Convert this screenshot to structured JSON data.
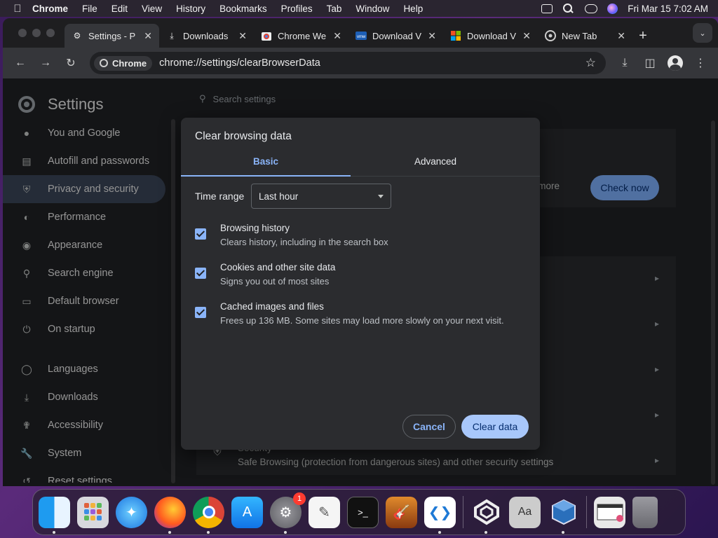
{
  "menubar": {
    "app_name": "Chrome",
    "items": [
      "File",
      "Edit",
      "View",
      "History",
      "Bookmarks",
      "Profiles",
      "Tab",
      "Window",
      "Help"
    ],
    "clock": "Fri Mar 15  7:02 AM"
  },
  "tabs": [
    {
      "title": "Settings - P",
      "icon": "gear-icon",
      "active": true
    },
    {
      "title": "Downloads",
      "icon": "download-icon",
      "active": false
    },
    {
      "title": "Chrome We",
      "icon": "chrome-web-store-icon",
      "active": false
    },
    {
      "title": "Download V",
      "icon": "vmware-icon",
      "active": false
    },
    {
      "title": "Download V",
      "icon": "microsoft-icon",
      "active": false
    },
    {
      "title": "New Tab",
      "icon": "chrome-icon",
      "active": false
    }
  ],
  "toolbar": {
    "chip_label": "Chrome",
    "url": "chrome://settings/clearBrowserData"
  },
  "settings": {
    "title": "Settings",
    "search_placeholder": "Search settings",
    "nav": [
      {
        "label": "You and Google",
        "icon": "person-icon",
        "active": false
      },
      {
        "label": "Autofill and passwords",
        "icon": "clipboard-icon",
        "active": false
      },
      {
        "label": "Privacy and security",
        "icon": "shield-icon",
        "active": true
      },
      {
        "label": "Performance",
        "icon": "speedometer-icon",
        "active": false
      },
      {
        "label": "Appearance",
        "icon": "palette-icon",
        "active": false
      },
      {
        "label": "Search engine",
        "icon": "search-icon",
        "active": false
      },
      {
        "label": "Default browser",
        "icon": "browser-icon",
        "active": false
      },
      {
        "label": "On startup",
        "icon": "power-icon",
        "active": false
      },
      {
        "label": "Languages",
        "icon": "globe-icon",
        "active": false
      },
      {
        "label": "Downloads",
        "icon": "download-icon",
        "active": false
      },
      {
        "label": "Accessibility",
        "icon": "accessibility-icon",
        "active": false
      },
      {
        "label": "System",
        "icon": "wrench-icon",
        "active": false
      },
      {
        "label": "Reset settings",
        "icon": "reset-icon",
        "active": false
      }
    ],
    "bg_partial_text": "d more",
    "check_now": "Check now",
    "security_title": "Security",
    "security_sub": "Safe Browsing (protection from dangerous sites) and other security settings"
  },
  "dialog": {
    "title": "Clear browsing data",
    "tabs": [
      "Basic",
      "Advanced"
    ],
    "active_tab": "Basic",
    "time_range_label": "Time range",
    "time_range_value": "Last hour",
    "options": [
      {
        "title": "Browsing history",
        "subtitle": "Clears history, including in the search box",
        "checked": true
      },
      {
        "title": "Cookies and other site data",
        "subtitle": "Signs you out of most sites",
        "checked": true
      },
      {
        "title": "Cached images and files",
        "subtitle": "Frees up 136 MB. Some sites may load more slowly on your next visit.",
        "checked": true
      }
    ],
    "cancel_label": "Cancel",
    "clear_label": "Clear data"
  },
  "dock": {
    "apps": [
      {
        "name": "finder-icon",
        "running": true
      },
      {
        "name": "launchpad-icon",
        "running": false
      },
      {
        "name": "safari-icon",
        "running": false
      },
      {
        "name": "firefox-icon",
        "running": true
      },
      {
        "name": "chrome-icon",
        "running": true
      },
      {
        "name": "app-store-icon",
        "running": false
      },
      {
        "name": "system-settings-icon",
        "running": true,
        "badge": "1"
      },
      {
        "name": "textedit-icon",
        "running": false
      },
      {
        "name": "terminal-icon",
        "running": false
      },
      {
        "name": "garageband-icon",
        "running": false
      },
      {
        "name": "vscode-icon",
        "running": true
      },
      {
        "name": "vmware-icon",
        "running": true
      },
      {
        "name": "dictionary-icon",
        "running": false
      },
      {
        "name": "virtualbox-icon",
        "running": true
      },
      {
        "name": "downloads-stack-icon",
        "running": false
      },
      {
        "name": "trash-icon",
        "running": false
      }
    ]
  }
}
